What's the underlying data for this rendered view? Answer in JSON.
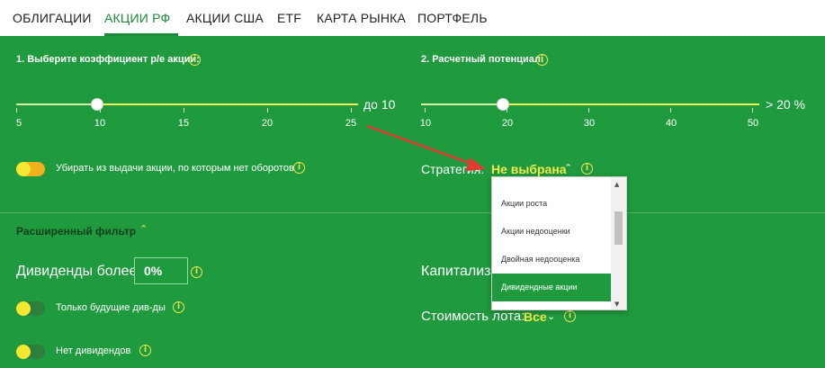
{
  "tabs": [
    {
      "label": "ОБЛИГАЦИИ",
      "active": false
    },
    {
      "label": "АКЦИИ РФ",
      "active": true
    },
    {
      "label": "АКЦИИ США",
      "active": false
    },
    {
      "label": "ETF",
      "active": false
    },
    {
      "label": "КАРТА РЫНКА",
      "active": false
    },
    {
      "label": "ПОРТФЕЛЬ",
      "active": false
    }
  ],
  "pe_filter": {
    "label": "1. Выберите коэффициент p/e акции:",
    "tick_labels": [
      "5",
      "10",
      "15",
      "20",
      "25"
    ],
    "end_label": "до 10",
    "value": 10
  },
  "potential_filter": {
    "label": "2. Расчетный потенциал:",
    "tick_labels": [
      "10",
      "20",
      "30",
      "40",
      "50"
    ],
    "end_label": "> 20 %",
    "value": 20
  },
  "hide_no_turnover": {
    "label": "Убирать из выдачи акции, по которым нет оборотов",
    "enabled": true
  },
  "strategy": {
    "label": "Стратегия:",
    "value": "Не выбрана",
    "options": [
      "Акции роста",
      "Акции недооценки",
      "Двойная недооценка",
      "Дивидендные акции"
    ],
    "highlighted": "Дивидендные акции"
  },
  "extended_filter": {
    "label": "Расширенный фильтр"
  },
  "dividends": {
    "label": "Дивиденды более:",
    "value": "0%"
  },
  "future_dividends": {
    "label": "Только будущие див-ды",
    "enabled": false
  },
  "no_dividends": {
    "label": "Нет дивидендов",
    "enabled": false
  },
  "capitalization": {
    "label": "Капитализа"
  },
  "lot_cost": {
    "label": "Стоимость лота:",
    "value": "Все"
  },
  "icons": {
    "info": "i",
    "chevron_up": "^",
    "chevron_down": "v",
    "scroll_up": "▲",
    "scroll_down": "▼"
  },
  "colors": {
    "accent_green": "#1f9a3e",
    "highlight_yellow": "#f2e84d",
    "toggle_orange": "#f3b21b",
    "annotation_red": "#e23a2e"
  }
}
